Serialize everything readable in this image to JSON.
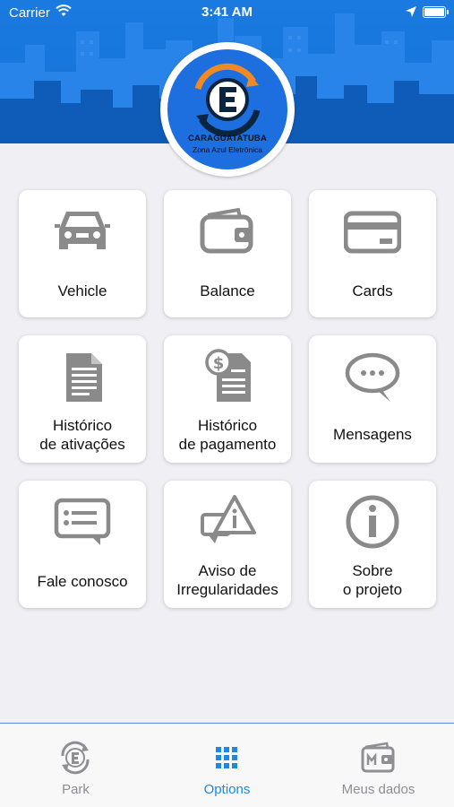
{
  "status_bar": {
    "carrier": "Carrier",
    "time": "3:41 AM"
  },
  "logo": {
    "title": "CARAGUATATUBA",
    "subtitle": "Zona Azul Eletrônica"
  },
  "menu": {
    "vehicle": "Vehicle",
    "balance": "Balance",
    "cards": "Cards",
    "activation_history": "Histórico\nde ativações",
    "payment_history": "Histórico\nde pagamento",
    "messages": "Mensagens",
    "contact": "Fale conosco",
    "irregularity": "Aviso de\nIrregularidades",
    "about": "Sobre\no projeto"
  },
  "tabbar": {
    "park": "Park",
    "options": "Options",
    "my_data": "Meus dados"
  },
  "colors": {
    "header": "#1572d6",
    "accent": "#1e88e5",
    "icon_gray": "#8a8a8a",
    "logo_orange": "#f08a24"
  }
}
